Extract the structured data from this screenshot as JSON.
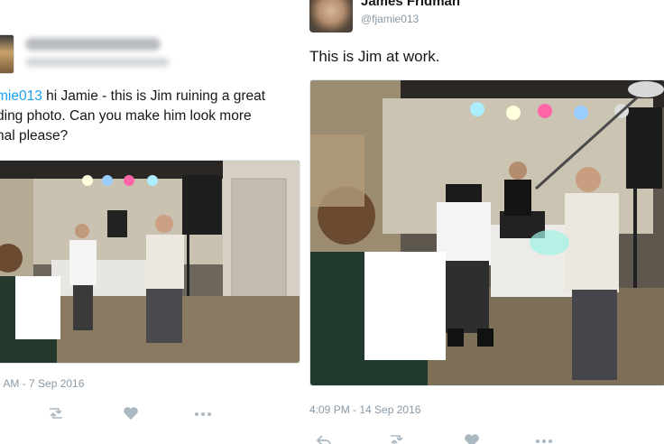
{
  "left_tweet": {
    "mention": "mie013",
    "text": " hi Jamie - this is Jim ruining a great",
    "line2": "ding photo. Can you make him look more",
    "line3": "nal please?",
    "timestamp": "3 AM - 7 Sep 2016",
    "actions": {
      "retweet_icon": "retweet-icon",
      "like_icon": "heart-icon",
      "more_icon": "more-icon"
    }
  },
  "right_tweet": {
    "display_name": "James Fridman",
    "handle": "@fjamie013",
    "text": "This is Jim at work.",
    "timestamp": "4:09 PM - 14 Sep 2016",
    "actions": {
      "reply_icon": "reply-icon",
      "retweet_icon": "retweet-icon",
      "like_icon": "heart-icon",
      "more_icon": "more-icon"
    }
  },
  "colors": {
    "link": "#1da1f2",
    "meta": "#8899a6",
    "icon": "#aab8c2",
    "text": "#14171a"
  }
}
